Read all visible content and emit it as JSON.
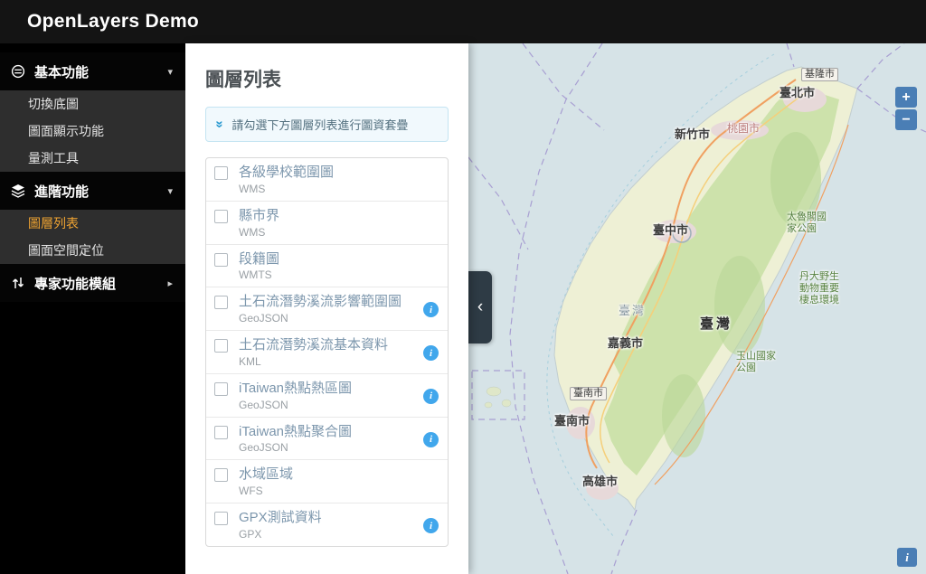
{
  "header": {
    "title": "OpenLayers Demo"
  },
  "sidebar": {
    "sections": [
      {
        "label": "基本功能",
        "caret": "▾",
        "items": [
          "切換底圖",
          "圖面顯示功能",
          "量測工具"
        ]
      },
      {
        "label": "進階功能",
        "caret": "▾",
        "items": [
          "圖層列表",
          "圖面空間定位"
        ]
      },
      {
        "label": "專家功能模組",
        "caret": "▸",
        "items": []
      }
    ]
  },
  "panel": {
    "title": "圖層列表",
    "notice": {
      "icon": "»",
      "text": "請勾選下方圖層列表進行圖資套疊"
    },
    "layers": [
      {
        "name": "各級學校範圍圖",
        "type": "WMS"
      },
      {
        "name": "縣市界",
        "type": "WMS"
      },
      {
        "name": "段籍圖",
        "type": "WMTS"
      },
      {
        "name": "土石流潛勢溪流影響範圍圖",
        "type": "GeoJSON",
        "info": "i"
      },
      {
        "name": "土石流潛勢溪流基本資料",
        "type": "KML",
        "info": "i"
      },
      {
        "name": "iTaiwan熱點熱區圖",
        "type": "GeoJSON",
        "info": "i"
      },
      {
        "name": "iTaiwan熱點聚合圖",
        "type": "GeoJSON",
        "info": "i"
      },
      {
        "name": "水域區域",
        "type": "WFS"
      },
      {
        "name": "GPX測試資料",
        "type": "GPX",
        "info": "i"
      }
    ]
  },
  "map": {
    "collapse_handle": "‹",
    "zoom_in": "+",
    "zoom_out": "−",
    "attribution": "i",
    "labels": [
      {
        "text": "基隆市"
      },
      {
        "text": "臺北市"
      },
      {
        "text": "桃園市"
      },
      {
        "text": "新竹市"
      },
      {
        "text": "臺中市"
      },
      {
        "text": "太魯閣國\n家公園"
      },
      {
        "text": "丹大野生\n動物重要\n棲息環境"
      },
      {
        "text": "臺灣"
      },
      {
        "text": "臺灣"
      },
      {
        "text": "嘉義市"
      },
      {
        "text": "玉山國家\n公園"
      },
      {
        "text": "臺南市"
      },
      {
        "text": "臺南市"
      },
      {
        "text": "高雄市"
      }
    ]
  },
  "colors": {
    "accent_active": "#f0a432",
    "info_icon": "#41a7ec",
    "control_blue": "#4a7eb5",
    "sea": "#d6e3e7"
  }
}
